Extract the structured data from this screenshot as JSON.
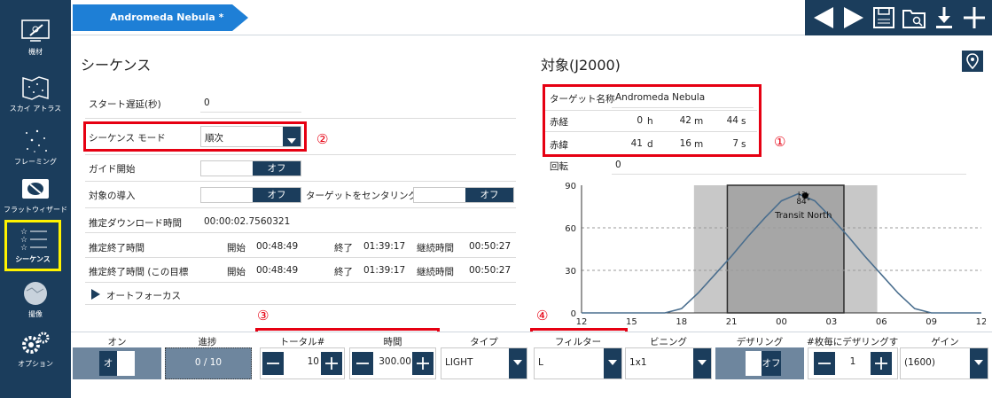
{
  "sidebar": {
    "items": [
      {
        "label": "機材",
        "icon": "telescope-icon"
      },
      {
        "label": "スカイ アトラス",
        "icon": "star-map-icon"
      },
      {
        "label": "フレーミング",
        "icon": "framing-icon"
      },
      {
        "label": "フラットウィザード",
        "icon": "flat-wizard-icon"
      },
      {
        "label": "シーケンス",
        "icon": "sequence-icon",
        "active": true
      },
      {
        "label": "撮像",
        "icon": "imaging-icon"
      },
      {
        "label": "オプション",
        "icon": "gear-icon"
      }
    ]
  },
  "tab": {
    "label": "Andromeda Nebula *"
  },
  "toolbar": {
    "icons": [
      "prev-icon",
      "next-icon",
      "save-icon",
      "open-folder-icon",
      "download-icon",
      "add-icon"
    ]
  },
  "sequence": {
    "title": "シーケンス",
    "start_delay_label": "スタート遅延(秒)",
    "start_delay_value": "0",
    "mode_label": "シーケンス モード",
    "mode_value": "順次",
    "guide_label": "ガイド開始",
    "guide_value": "オフ",
    "slew_label": "対象の導入",
    "slew_value": "オフ",
    "center_label": "ターゲットをセンタリング",
    "center_value": "オフ",
    "dl_label": "推定ダウンロード時間",
    "dl_value": "00:00:02.7560321",
    "end_label": "推定終了時間",
    "end2_label": "推定終了時間 (この目標",
    "start_w": "開始",
    "end_w": "終了",
    "dur_w": "継続時間",
    "t_start": "00:48:49",
    "t_end": "01:39:17",
    "t_dur": "00:50:27",
    "t2_start": "00:48:49",
    "t2_end": "01:39:17",
    "t2_dur": "00:50:27",
    "autofocus": "オートフォーカス"
  },
  "target": {
    "title": "対象(J2000)",
    "name_label": "ターゲット名称",
    "name_value": "Andromeda Nebula",
    "ra_label": "赤経",
    "ra_h": "0",
    "ra_h_u": "h",
    "ra_m": "42",
    "ra_m_u": "m",
    "ra_s": "44",
    "ra_s_u": "s",
    "dec_label": "赤緯",
    "dec_d": "41",
    "dec_d_u": "d",
    "dec_m": "16",
    "dec_m_u": "m",
    "dec_s": "7",
    "dec_s_u": "s",
    "rot_label": "回転",
    "rot_value": "0"
  },
  "chart_data": {
    "type": "line",
    "yticks": [
      "90",
      "60",
      "30",
      "0"
    ],
    "xticks": [
      "12",
      "15",
      "18",
      "21",
      "00",
      "03",
      "06",
      "09",
      "12"
    ],
    "ylim": [
      0,
      90
    ],
    "x": [
      12,
      13,
      14,
      15,
      16,
      17,
      18,
      19,
      20,
      21,
      22,
      23,
      24,
      25,
      26,
      27,
      28,
      29,
      30,
      31,
      32,
      33,
      34,
      35,
      36
    ],
    "y": [
      0,
      0,
      0,
      0,
      0,
      0,
      3,
      14,
      27,
      40,
      54,
      67,
      79,
      84,
      79,
      67,
      54,
      40,
      27,
      14,
      3,
      0,
      0,
      0,
      0
    ],
    "annotation_lines": [
      "ﾄﾗﾝ",
      "84°",
      "Transit North"
    ]
  },
  "markers": [
    "②",
    "①",
    "③",
    "④"
  ],
  "table": {
    "headers": [
      "オン",
      "進捗",
      "トータル#",
      "時間",
      "タイプ",
      "フィルター",
      "ビニング",
      "デザリング",
      "#枚毎にデザリングする",
      "ゲイン"
    ],
    "row": {
      "on": "オン",
      "progress": "0 / 10",
      "total": "10",
      "time": "300.00",
      "type": "LIGHT",
      "filter": "L",
      "binning": "1x1",
      "dither": "オフ",
      "dither_every": "1",
      "gain": "(1600)"
    }
  }
}
